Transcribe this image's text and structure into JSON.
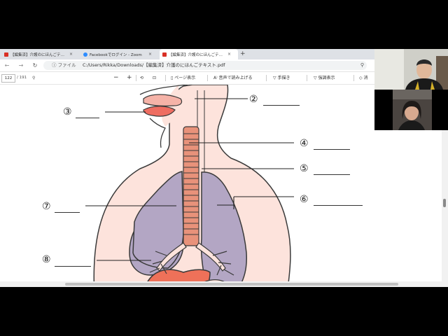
{
  "browser": {
    "tabs": [
      {
        "title": "【編集済】介護のにほんごテキスト.pdf",
        "icon": "pdf-icon",
        "color": "#d93025",
        "active": false
      },
      {
        "title": "Facebookでログイン - Zoom",
        "icon": "zoom-icon",
        "color": "#2d8cff",
        "active": false
      },
      {
        "title": "【編集済】介護のにほんごテキスト.pdf",
        "icon": "pdf-icon",
        "color": "#d93025",
        "active": true
      }
    ],
    "new_tab": "+",
    "close_glyph": "×",
    "address": {
      "scheme_label": "ファイル",
      "url": "C:/Users/Rikka/Downloads/【編集済】介護のにほんごテキスト.pdf"
    }
  },
  "pdf_toolbar": {
    "page_current": "122",
    "page_total": "/ 191",
    "minus": "−",
    "plus": "+",
    "page_view_label": "ページ表示",
    "read_aloud_label": "音声で読み上げる",
    "draw_label": "手描き",
    "highlight_label": "強調表示",
    "erase_label": "消"
  },
  "worksheet": {
    "labels": [
      "②",
      "③",
      "④",
      "⑤",
      "⑥",
      "⑦",
      "⑧"
    ]
  },
  "colors": {
    "skin": "#fde3dc",
    "lung": "#b3a6c4",
    "liver": "#ee7159",
    "trachea": "#e8927a",
    "outline": "#3a3a3a"
  }
}
